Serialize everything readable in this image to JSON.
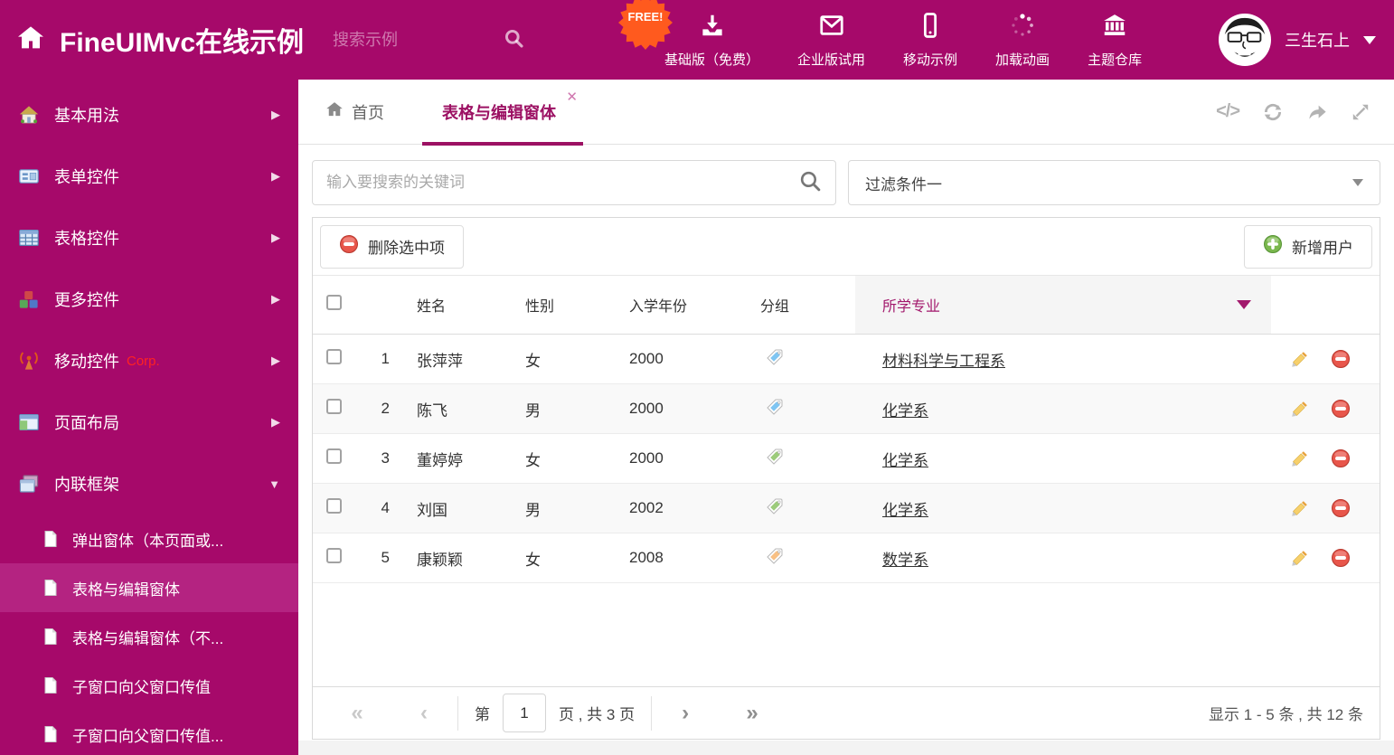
{
  "colors": {
    "brand": "#a6096a",
    "brand_selected": "#b42381",
    "active_tab": "#9c1163",
    "free_badge": "#ff5a1e",
    "tag_blue": "#7fc5f2",
    "tag_green": "#9ccb7b",
    "tag_orange": "#f8c084"
  },
  "header": {
    "title": "FineUIMvc在线示例",
    "search_placeholder": "搜索示例",
    "free_badge": "FREE!",
    "nav": [
      {
        "label": "基础版（免费）",
        "icon": "download-icon"
      },
      {
        "label": "企业版试用",
        "icon": "envelope-icon"
      },
      {
        "label": "移动示例",
        "icon": "mobile-icon"
      },
      {
        "label": "加载动画",
        "icon": "spinner-icon"
      },
      {
        "label": "主题仓库",
        "icon": "bank-icon"
      }
    ],
    "user_name": "三生石上"
  },
  "sidebar": {
    "items": [
      {
        "label": "基本用法",
        "icon": "home-icon"
      },
      {
        "label": "表单控件",
        "icon": "form-icon"
      },
      {
        "label": "表格控件",
        "icon": "table-icon"
      },
      {
        "label": "更多控件",
        "icon": "cubes-icon"
      },
      {
        "label": "移动控件",
        "badge": "Corp.",
        "icon": "antenna-icon"
      },
      {
        "label": "页面布局",
        "icon": "layout-icon"
      },
      {
        "label": "内联框架",
        "icon": "frames-icon"
      }
    ],
    "subitems": [
      {
        "label": "弹出窗体（本页面或..."
      },
      {
        "label": "表格与编辑窗体"
      },
      {
        "label": "表格与编辑窗体（不..."
      },
      {
        "label": "子窗口向父窗口传值"
      },
      {
        "label": "子窗口向父窗口传值..."
      }
    ]
  },
  "tabs": {
    "home_label": "首页",
    "active_label": "表格与编辑窗体"
  },
  "filter": {
    "search_placeholder": "输入要搜索的关键词",
    "dropdown_value": "过滤条件一"
  },
  "toolbar": {
    "delete_label": "删除选中项",
    "add_label": "新增用户"
  },
  "table": {
    "headers": {
      "name": "姓名",
      "gender": "性别",
      "year": "入学年份",
      "group": "分组",
      "major": "所学专业"
    },
    "rows": [
      {
        "num": "1",
        "name": "张萍萍",
        "gender": "女",
        "year": "2000",
        "tag_color": "#7fc5f2",
        "major": "材料科学与工程系"
      },
      {
        "num": "2",
        "name": "陈飞",
        "gender": "男",
        "year": "2000",
        "tag_color": "#7fc5f2",
        "major": "化学系"
      },
      {
        "num": "3",
        "name": "董婷婷",
        "gender": "女",
        "year": "2000",
        "tag_color": "#9ccb7b",
        "major": "化学系"
      },
      {
        "num": "4",
        "name": "刘国",
        "gender": "男",
        "year": "2002",
        "tag_color": "#9ccb7b",
        "major": "化学系"
      },
      {
        "num": "5",
        "name": "康颖颖",
        "gender": "女",
        "year": "2008",
        "tag_color": "#f8c084",
        "major": "数学系"
      }
    ]
  },
  "pagination": {
    "first_label": "«",
    "prev_label": "‹",
    "next_label": "›",
    "last_label": "»",
    "page_prefix": "第",
    "page_value": "1",
    "page_suffix": "页 , 共 3 页",
    "summary": "显示 1 - 5 条 , 共 12 条"
  }
}
